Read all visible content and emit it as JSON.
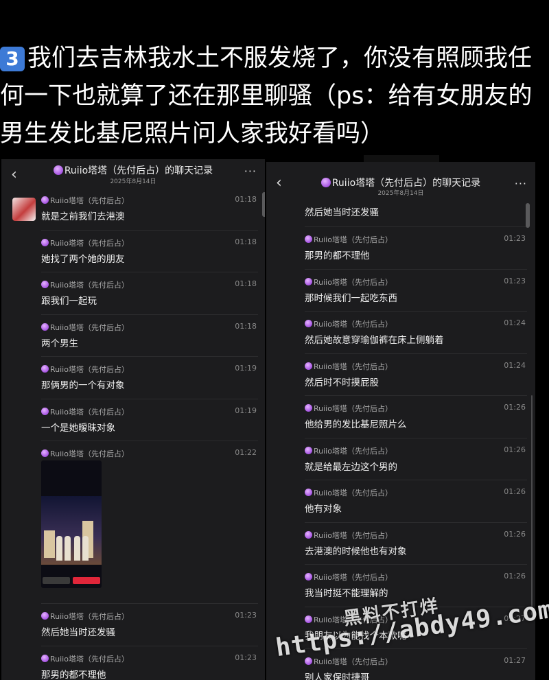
{
  "caption": {
    "badge": "3",
    "lines": [
      "我们去吉林我水土不服发烧了，你没有照顾我任",
      "何一下也就算了还在那里聊骚（ps：给有女朋友的",
      "男生发比基尼照片问人家我好看吗）"
    ]
  },
  "left": {
    "header": {
      "back": "‹",
      "title": "Ruiio塔塔（先付后占）的聊天记录",
      "date": "2025年8月14日",
      "more": "···"
    },
    "messages": [
      {
        "sender": "Ruiio塔塔（先付后占）",
        "time": "01:18",
        "text": "就是之前我们去港澳"
      },
      {
        "sender": "Ruiio塔塔（先付后占）",
        "time": "01:18",
        "text": "她找了两个她的朋友"
      },
      {
        "sender": "Ruiio塔塔（先付后占）",
        "time": "01:18",
        "text": "跟我们一起玩"
      },
      {
        "sender": "Ruiio塔塔（先付后占）",
        "time": "01:18",
        "text": "两个男生"
      },
      {
        "sender": "Ruiio塔塔（先付后占）",
        "time": "01:19",
        "text": "那俩男的一个有对象"
      },
      {
        "sender": "Ruiio塔塔（先付后占）",
        "time": "01:19",
        "text": "一个是她暧昧对象"
      },
      {
        "sender": "Ruiio塔塔（先付后占）",
        "time": "01:22",
        "text": ""
      },
      {
        "sender": "Ruiio塔塔（先付后占）",
        "time": "01:23",
        "text": "然后她当时还发骚"
      },
      {
        "sender": "Ruiio塔塔（先付后占）",
        "time": "01:23",
        "text": "那男的都不理他"
      }
    ]
  },
  "right": {
    "header": {
      "back": "‹",
      "title": "Ruiio塔塔（先付后占）的聊天记录",
      "date": "2025年8月14日",
      "more": "···"
    },
    "first_text": "然后她当时还发骚",
    "messages": [
      {
        "sender": "Ruiio塔塔（先付后占）",
        "time": "01:23",
        "text": "那男的都不理他"
      },
      {
        "sender": "Ruiio塔塔（先付后占）",
        "time": "01:23",
        "text": "那时候我们一起吃东西"
      },
      {
        "sender": "Ruiio塔塔（先付后占）",
        "time": "01:24",
        "text": "然后她故意穿瑜伽裤在床上侧躺着"
      },
      {
        "sender": "Ruiio塔塔（先付后占）",
        "time": "01:24",
        "text": "然后时不时摸屁股"
      },
      {
        "sender": "Ruiio塔塔（先付后占）",
        "time": "01:26",
        "text": "他给男的发比基尼照片么"
      },
      {
        "sender": "Ruiio塔塔（先付后占）",
        "time": "01:26",
        "text": "就是给最左边这个男的"
      },
      {
        "sender": "Ruiio塔塔（先付后占）",
        "time": "01:26",
        "text": "他有对象"
      },
      {
        "sender": "Ruiio塔塔（先付后占）",
        "time": "01:26",
        "text": "去港澳的时候他也有对象"
      },
      {
        "sender": "Ruiio塔塔（先付后占）",
        "time": "01:26",
        "text": "我当时挺不能理解的"
      },
      {
        "sender": "Ruiio塔塔（先付后占）",
        "time": "01:27",
        "text": "我朋友以为能找个本款呢"
      },
      {
        "sender": "Ruiio塔塔（先付后占）",
        "time": "01:27",
        "text": "别人家保时捷哥"
      }
    ]
  },
  "watermark": {
    "line1": "黑料不打烊",
    "line2": "https://abdy49.com"
  }
}
